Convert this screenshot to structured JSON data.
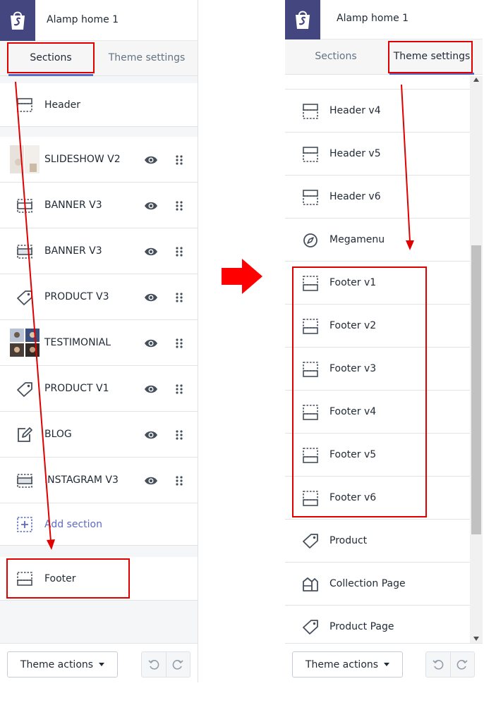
{
  "left": {
    "store_name": "Alamp home 1",
    "tabs": [
      {
        "label": "Sections"
      },
      {
        "label": "Theme settings"
      }
    ],
    "header_row": {
      "label": "Header"
    },
    "sections": [
      {
        "label": "SLIDESHOW V2",
        "icon": "slideshow-thumbnail"
      },
      {
        "label": "BANNER V3",
        "icon": "banner-icon"
      },
      {
        "label": "BANNER V3",
        "icon": "banner-icon"
      },
      {
        "label": "PRODUCT V3",
        "icon": "tag-icon"
      },
      {
        "label": "TESTIMONIAL",
        "icon": "testimonial-thumbnail"
      },
      {
        "label": "PRODUCT V1",
        "icon": "tag-icon"
      },
      {
        "label": "BLOG",
        "icon": "edit-icon"
      },
      {
        "label": "INSTAGRAM V3",
        "icon": "banner-icon"
      }
    ],
    "add_section": "Add section",
    "footer_row": {
      "label": "Footer"
    },
    "theme_actions": "Theme actions"
  },
  "right": {
    "store_name": "Alamp home 1",
    "tabs": [
      {
        "label": "Sections"
      },
      {
        "label": "Theme settings"
      }
    ],
    "items": [
      {
        "label": "Header v4",
        "icon": "layout-icon"
      },
      {
        "label": "Header v5",
        "icon": "layout-icon"
      },
      {
        "label": "Header v6",
        "icon": "layout-icon"
      },
      {
        "label": "Megamenu",
        "icon": "compass-icon"
      },
      {
        "label": "Footer v1",
        "icon": "footer-icon"
      },
      {
        "label": "Footer v2",
        "icon": "footer-icon"
      },
      {
        "label": "Footer v3",
        "icon": "footer-icon"
      },
      {
        "label": "Footer v4",
        "icon": "footer-icon"
      },
      {
        "label": "Footer v5",
        "icon": "footer-icon"
      },
      {
        "label": "Footer v6",
        "icon": "footer-icon"
      },
      {
        "label": "Product",
        "icon": "tag-icon"
      },
      {
        "label": "Collection Page",
        "icon": "collection-icon"
      },
      {
        "label": "Product Page",
        "icon": "tag-icon"
      }
    ],
    "theme_actions": "Theme actions"
  },
  "colors": {
    "accent": "#5c6ac4",
    "logo_bg": "#43467f",
    "annotation": "#e00000"
  }
}
